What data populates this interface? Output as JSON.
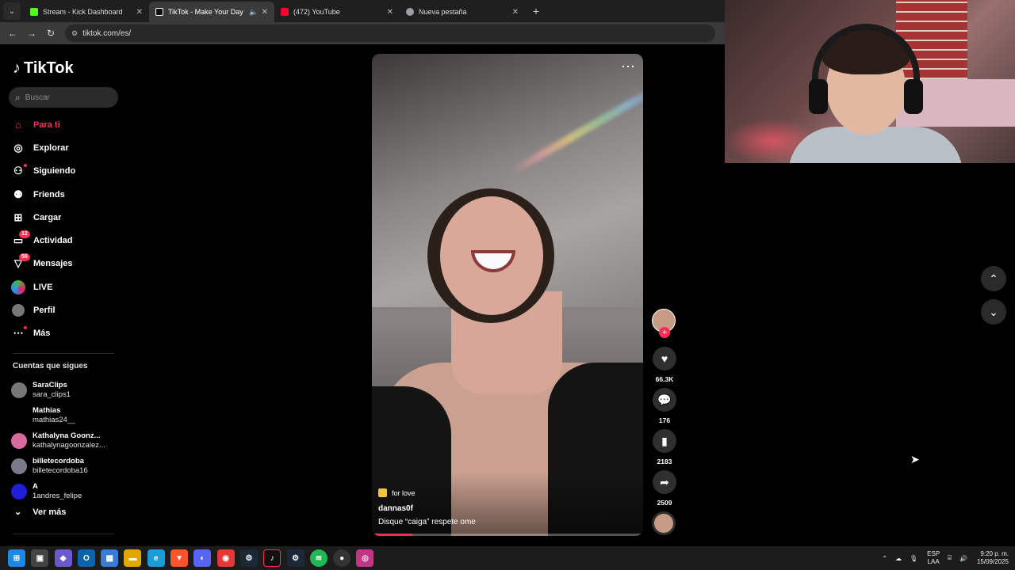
{
  "browser": {
    "tabs": [
      {
        "title": "Stream - Kick Dashboard",
        "color": "#53fc18"
      },
      {
        "title": "TikTok - Make Your Day",
        "color": "#ffffff",
        "active": true
      },
      {
        "title": "(472) YouTube",
        "color": "#ff0033"
      },
      {
        "title": "Nueva pestaña",
        "color": "#9aa0a6"
      }
    ],
    "url": "tiktok.com/es/"
  },
  "sidebar": {
    "logo": "TikTok",
    "search_placeholder": "Buscar",
    "nav": [
      {
        "label": "Para ti",
        "icon": "home-icon"
      },
      {
        "label": "Explorar",
        "icon": "compass-icon"
      },
      {
        "label": "Siguiendo",
        "icon": "following-icon"
      },
      {
        "label": "Friends",
        "icon": "friends-icon"
      },
      {
        "label": "Cargar",
        "icon": "upload-icon"
      },
      {
        "label": "Actividad",
        "icon": "activity-icon",
        "badge": "12"
      },
      {
        "label": "Mensajes",
        "icon": "messages-icon",
        "badge": "55"
      },
      {
        "label": "LIVE",
        "icon": "live-icon"
      },
      {
        "label": "Perfil",
        "icon": "profile-avatar"
      },
      {
        "label": "Más",
        "icon": "more-icon"
      }
    ],
    "following_title": "Cuentas que sigues",
    "following": [
      {
        "name": "SaraClips",
        "user": "sara_clips1",
        "color": "#777777"
      },
      {
        "name": "Mathias",
        "user": "mathias24__",
        "color": "#000000"
      },
      {
        "name": "Kathalyna Goonz...",
        "user": "kathalynagoonzalez...",
        "color": "#d86aa0"
      },
      {
        "name": "billetecordoba",
        "user": "billetecordoba16",
        "color": "#7a7a8a"
      },
      {
        "name": "A",
        "user": "1andres_felipe",
        "color": "#1f1fd8"
      }
    ],
    "see_more": "Ver más"
  },
  "video": {
    "tag": "for love",
    "author": "dannas0f",
    "caption": "Disque “caiga” respete ome",
    "progress": 0.15
  },
  "actions": {
    "likes": "66.3K",
    "comments": "176",
    "saves": "2183",
    "shares": "2509"
  },
  "taskbar": {
    "lang_top": "ESP",
    "lang_bottom": "LAA",
    "time": "9:20 p. m.",
    "date": "15/09/2025"
  }
}
